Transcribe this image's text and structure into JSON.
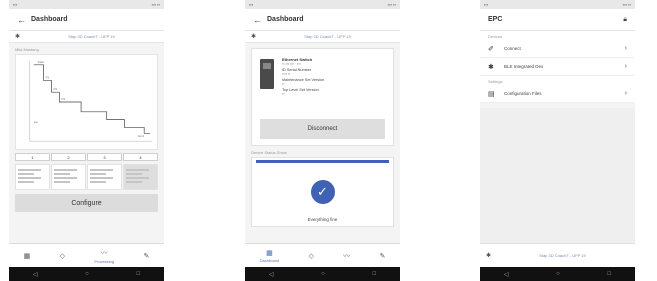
{
  "screens": [
    {
      "title": "Dashboard",
      "back_icon": "arrow-left-icon",
      "device_label": "Stap 3D CoachT - UFP 19",
      "section_label": "Mild Mustang",
      "chart_point_labels": [
        "Start",
        "P1",
        "P2",
        "P3",
        "P4",
        "End"
      ],
      "steps": [
        "1",
        "2",
        "3",
        "4"
      ],
      "configure_label": "Configure",
      "bottom_nav": [
        {
          "icon": "grid-icon"
        },
        {
          "icon": "diamond-icon"
        },
        {
          "icon": "pulse-icon",
          "label": "Processing"
        },
        {
          "icon": "wrench-icon"
        }
      ]
    },
    {
      "title": "Dashboard",
      "back_icon": "arrow-left-icon",
      "device_label": "Stap 3D CoachT - UFP 19",
      "device_name": "Ethernet Switch",
      "device_lines": [
        "ID Serial Number",
        "Serial Number",
        "Maintenance Set Version",
        "Top Level Set Version"
      ],
      "disconnect_label": "Disconnect",
      "status_section_label": "Device Status Show",
      "status_text": "Everything fine",
      "bottom_nav": [
        {
          "icon": "grid-icon",
          "label": "Dashboard"
        },
        {
          "icon": "diamond-icon"
        },
        {
          "icon": "pulse-icon"
        },
        {
          "icon": "wrench-icon"
        }
      ]
    },
    {
      "title": "EPC",
      "lock_icon": "lock-icon",
      "section1_label": "Devices",
      "section2_label": "Settings",
      "menu_items": [
        {
          "icon": "wand-icon",
          "label": "Connect"
        },
        {
          "icon": "bluetooth-icon",
          "label": "BLE Integrated Dev"
        },
        {
          "icon": "document-icon",
          "label": "Configuration Files"
        }
      ],
      "device_label": "Stap 3D CoachT - UFP 19"
    }
  ]
}
